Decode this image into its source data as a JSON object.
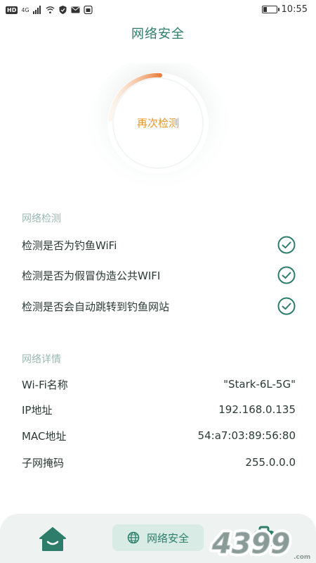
{
  "status_bar": {
    "network_badge": "HD",
    "signal_label": "4G",
    "time": "10:55"
  },
  "header": {
    "title": "网络安全"
  },
  "scan": {
    "button_label": "再次检测"
  },
  "detection": {
    "section_title": "网络检测",
    "items": [
      {
        "label": "检测是否为钓鱼WiFi"
      },
      {
        "label": "检测是否为假冒伪造公共WIFI"
      },
      {
        "label": "检测是否会自动跳转到钓鱼网站"
      }
    ]
  },
  "details": {
    "section_title": "网络详情",
    "rows": [
      {
        "label": "Wi-Fi名称",
        "value": "\"Stark-6L-5G\""
      },
      {
        "label": "IP地址",
        "value": "192.168.0.135"
      },
      {
        "label": "MAC地址",
        "value": "54:a7:03:89:56:80"
      },
      {
        "label": "子网掩码",
        "value": "255.0.0.0"
      }
    ]
  },
  "bottom_nav": {
    "active_label": "网络安全",
    "icons": [
      "home-icon",
      "globe-icon",
      "toolbox-icon"
    ]
  },
  "watermark": {
    "text": "4399"
  },
  "colors": {
    "brand": "#2e7d6b",
    "accent": "#e8962c",
    "section_title": "#9ab8b0",
    "nav_bg": "#eef3f1",
    "pill_bg": "#d8ebe4"
  }
}
